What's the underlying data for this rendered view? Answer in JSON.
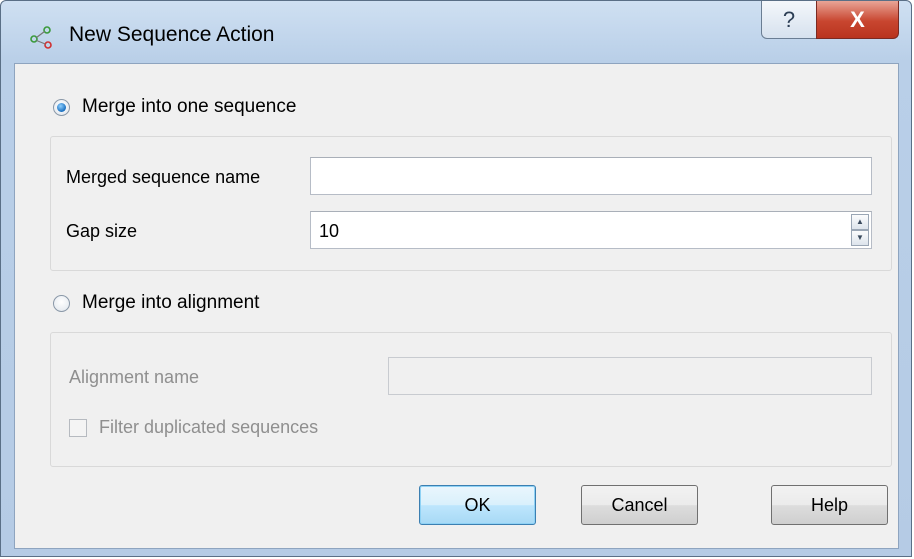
{
  "window": {
    "title": "New Sequence Action",
    "help_glyph": "?",
    "close_glyph": "X"
  },
  "merge_one": {
    "label": "Merge into one sequence",
    "checked": true,
    "name_label": "Merged sequence name",
    "name_value": "",
    "gap_label": "Gap size",
    "gap_value": "10"
  },
  "merge_alignment": {
    "label": "Merge into alignment",
    "checked": false,
    "name_label": "Alignment name",
    "name_value": "",
    "filter_label": "Filter duplicated sequences",
    "filter_checked": false
  },
  "buttons": {
    "ok": "OK",
    "cancel": "Cancel",
    "help": "Help"
  },
  "icons": {
    "app": "sequence-network-icon",
    "spin_up": "▲",
    "spin_down": "▼"
  }
}
